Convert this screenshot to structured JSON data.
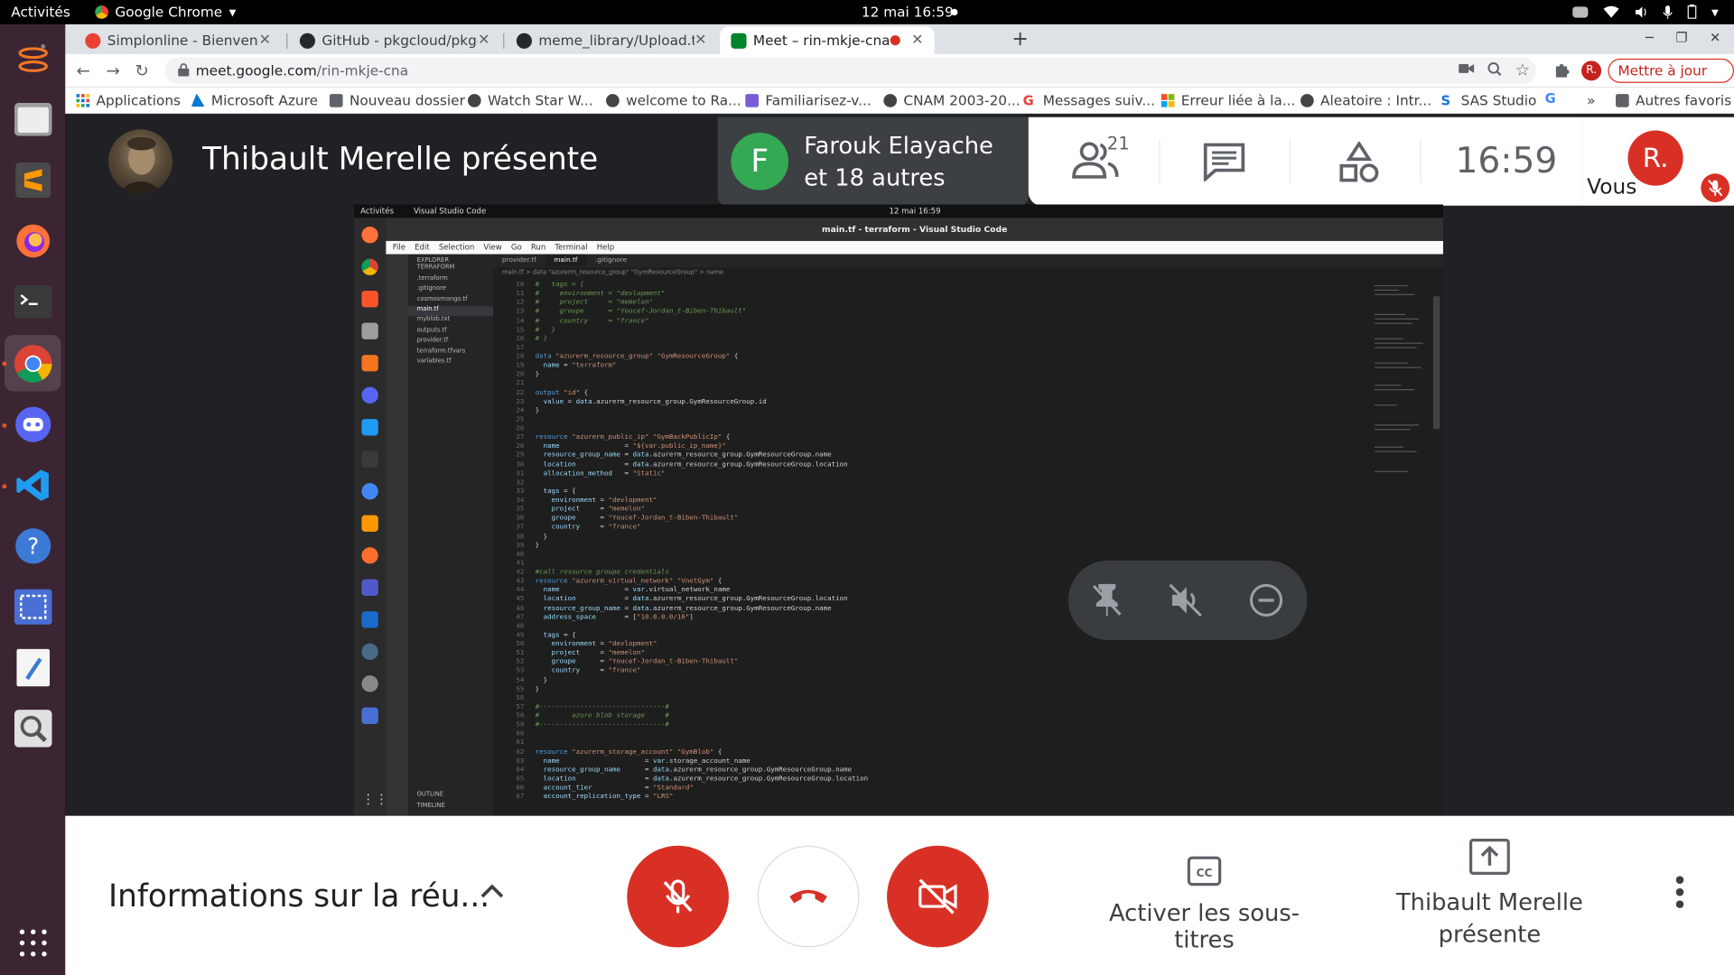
{
  "system": {
    "activities": "Activités",
    "app_menu": "Google Chrome",
    "clock": "12 mai  16:59"
  },
  "browser": {
    "tabs": [
      {
        "title": "Simplonline - Bienvenue s",
        "favicon_color": "#e94235"
      },
      {
        "title": "GitHub - pkgcloud/pkgclo",
        "favicon_color": "#24292e"
      },
      {
        "title": "meme_library/Upload.tsx",
        "favicon_color": "#24292e"
      },
      {
        "title": "Meet – rin-mkje-cna",
        "favicon_color": "#00832d"
      }
    ],
    "url_host": "meet.google.com",
    "url_path": "/rin-mkje-cna",
    "profile_initial": "R.",
    "update_label": "Mettre à jour",
    "bookmarks": [
      {
        "label": "Applications",
        "color": "#1a73e8"
      },
      {
        "label": "Microsoft Azure",
        "color": "#0078d4"
      },
      {
        "label": "Nouveau dossier",
        "color": "#5f6368"
      },
      {
        "label": "Watch Star W...",
        "color": "#444"
      },
      {
        "label": "welcome to Ra...",
        "color": "#444"
      },
      {
        "label": "Familiarisez-v...",
        "color": "#7b5cd6"
      },
      {
        "label": "CNAM 2003-20...",
        "color": "#444"
      },
      {
        "label": "Messages suiv...",
        "color": "#ea4335"
      },
      {
        "label": "Erreur liée à la...",
        "color": "#f25022"
      },
      {
        "label": "Aleatoire : Intr...",
        "color": "#444"
      },
      {
        "label": "SAS Studio",
        "color": "#1a73e8"
      }
    ],
    "more_bookmarks": "»",
    "other_bookmarks": "Autres favoris"
  },
  "meet": {
    "presenter_title": "Thibault Merelle présente",
    "participant_initial": "F",
    "participant_name": "Farouk Elayache et 18 autres",
    "people_count": "21",
    "time": "16:59",
    "self_initial": "R.",
    "self_label": "Vous",
    "meeting_info": "Informations sur la réu...",
    "captions_label": "Activer les sous-titres",
    "presenting_label": "Thibault Merelle présente",
    "colors": {
      "danger": "#d93025",
      "avatar_green": "#34a853"
    }
  },
  "shared_screen": {
    "top_activities": "Activités",
    "top_app": "Visual Studio Code",
    "top_clock": "12 mai  16:59",
    "window_title": "main.tf - terraform - Visual Studio Code",
    "menu": [
      "File",
      "Edit",
      "Selection",
      "View",
      "Go",
      "Run",
      "Terminal",
      "Help"
    ],
    "explorer_title": "EXPLORER",
    "files": [
      "TERRAFORM",
      ".terraform",
      ".gitignore",
      "cosmosmongo.tf",
      "main.tf",
      "myblob.txt",
      "outputs.tf",
      "provider.tf",
      "terraform.tfvars",
      "variables.tf"
    ],
    "editor_tabs": [
      "provider.tf",
      "main.tf",
      ".gitignore"
    ],
    "breadcrumb": "main.tf > data \"azurerm_resource_group\" \"GymResourceGroup\" > name",
    "outline_label": "OUTLINE",
    "timeline_label": "TIMELINE"
  }
}
